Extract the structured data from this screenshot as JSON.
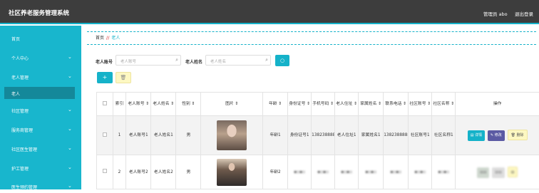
{
  "header": {
    "title": "社区养老服务管理系统",
    "user": "管理员 abo",
    "logout": "退出登录"
  },
  "sidebar": {
    "items": [
      {
        "label": "首页",
        "chevron": false
      },
      {
        "label": "个人中心",
        "chevron": true
      },
      {
        "label": "老人管理",
        "chevron": true
      },
      {
        "label": "老人",
        "chevron": false,
        "active": true
      },
      {
        "label": "社区管理",
        "chevron": true
      },
      {
        "label": "服务商管理",
        "chevron": true
      },
      {
        "label": "社区医生管理",
        "chevron": true
      },
      {
        "label": "护工管理",
        "chevron": true
      },
      {
        "label": "医生预约管理",
        "chevron": true
      }
    ]
  },
  "breadcrumb": {
    "home": "首页",
    "separator": "//",
    "current": "老人"
  },
  "search": {
    "account_label": "老人账号",
    "account_placeholder": "老人账号",
    "name_label": "老人姓名",
    "name_placeholder": "老人姓名",
    "search_icon": "search-icon"
  },
  "toolbar": {
    "add_icon": "+",
    "delete_icon": "🗑"
  },
  "table": {
    "headers": [
      "",
      "索引",
      "老人账号 ⇕",
      "老人姓名 ⇕",
      "性别 ⇕",
      "图片 ⇕",
      "年龄 ⇕",
      "身份证号 ⇕",
      "手机号码 ⇕",
      "老人住址 ⇕",
      "家属姓名 ⇕",
      "联系电话 ⇕",
      "社区账号 ⇕",
      "社区名称 ⇕",
      "操作"
    ],
    "rows": [
      {
        "index": "1",
        "account": "老人账号1",
        "name": "老人姓名1",
        "gender": "男",
        "age": "年龄1",
        "idcard": "身份证号1",
        "phone": "13823888881",
        "address": "老人住址1",
        "family": "家属姓名1",
        "contact": "13823888881",
        "community_account": "社区账号1",
        "community_name": "社区名称1"
      },
      {
        "index": "2",
        "account": "老人账号2",
        "name": "老人姓名2",
        "gender": "男",
        "age": "年龄2"
      }
    ],
    "actions": {
      "detail": "详情",
      "edit": "修改",
      "delete": "删除"
    }
  },
  "colors": {
    "accent": "#15b2c9",
    "topbar": "#3d3d3d",
    "active_menu": "#14889a",
    "edit": "#5b5aa3",
    "delete": "#fdf8c2"
  }
}
